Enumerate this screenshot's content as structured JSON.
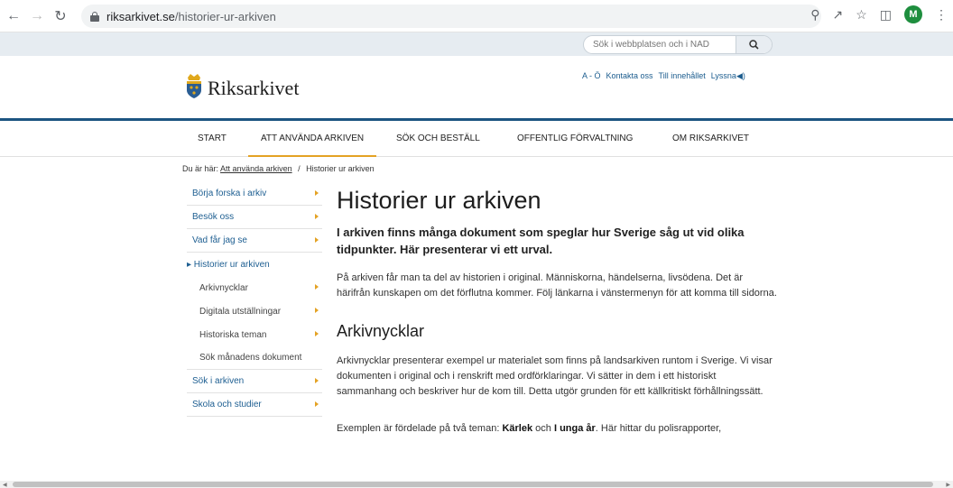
{
  "browser": {
    "url_host": "riksarkivet.se",
    "url_path": "/historier-ur-arkiven",
    "profile_initial": "M"
  },
  "topbar": {
    "search_placeholder": "Sök i webbplatsen och i NAD"
  },
  "header": {
    "logo_text": "Riksarkivet",
    "links": [
      "A - Ö",
      "Kontakta oss",
      "Till innehållet",
      "Lyssna"
    ]
  },
  "mainnav": {
    "items": [
      "START",
      "ATT ANVÄNDA ARKIVEN",
      "SÖK OCH BESTÄLL",
      "OFFENTLIG FÖRVALTNING",
      "OM RIKSARKIVET"
    ],
    "active": "ATT ANVÄNDA ARKIVEN"
  },
  "breadcrumb": {
    "prefix": "Du är här:",
    "link": "Att använda arkiven",
    "separator": "/",
    "current": "Historier ur arkiven"
  },
  "leftmenu": {
    "items": [
      {
        "label": "Börja forska i arkiv"
      },
      {
        "label": "Besök oss"
      },
      {
        "label": "Vad får jag se"
      },
      {
        "label": "▸ Historier ur arkiven"
      },
      {
        "label": "Arkivnycklar"
      },
      {
        "label": "Digitala utställningar"
      },
      {
        "label": "Historiska teman"
      },
      {
        "label": "Sök månadens dokument"
      },
      {
        "label": "Sök i arkiven"
      },
      {
        "label": "Skola och studier"
      }
    ]
  },
  "article": {
    "title": "Historier ur arkiven",
    "lead": "I arkiven finns många dokument som speglar hur Sverige såg ut vid olika tidpunkter. Här presenterar vi ett urval.",
    "intro": "På arkiven får man ta del av historien i original. Människorna, händelserna, livsödena. Det är härifrån kunskapen om det förflutna kommer. Följ länkarna i vänstermenyn för att komma till sidorna.",
    "section_title": "Arkivnycklar",
    "section_text": "Arkivnycklar presenterar exempel ur materialet som finns på landsarkiven runtom i Sverige. Vi visar dokumenten i original och i renskrift med ordförklaringar. Vi sätter in dem i ett historiskt sammanhang och beskriver hur de kom till. Detta utgör grunden för ett källkritiskt förhållningssätt.",
    "themes_prefix": "Exemplen är fördelade på två teman: ",
    "theme1": "Kärlek",
    "themes_and": " och ",
    "theme2": "I unga år",
    "themes_suffix": ". Här hittar du polisrapporter,"
  },
  "colors": {
    "nav_blue": "#1c5481",
    "link_blue": "#1d5e91",
    "accent_gold": "#e4a224"
  }
}
